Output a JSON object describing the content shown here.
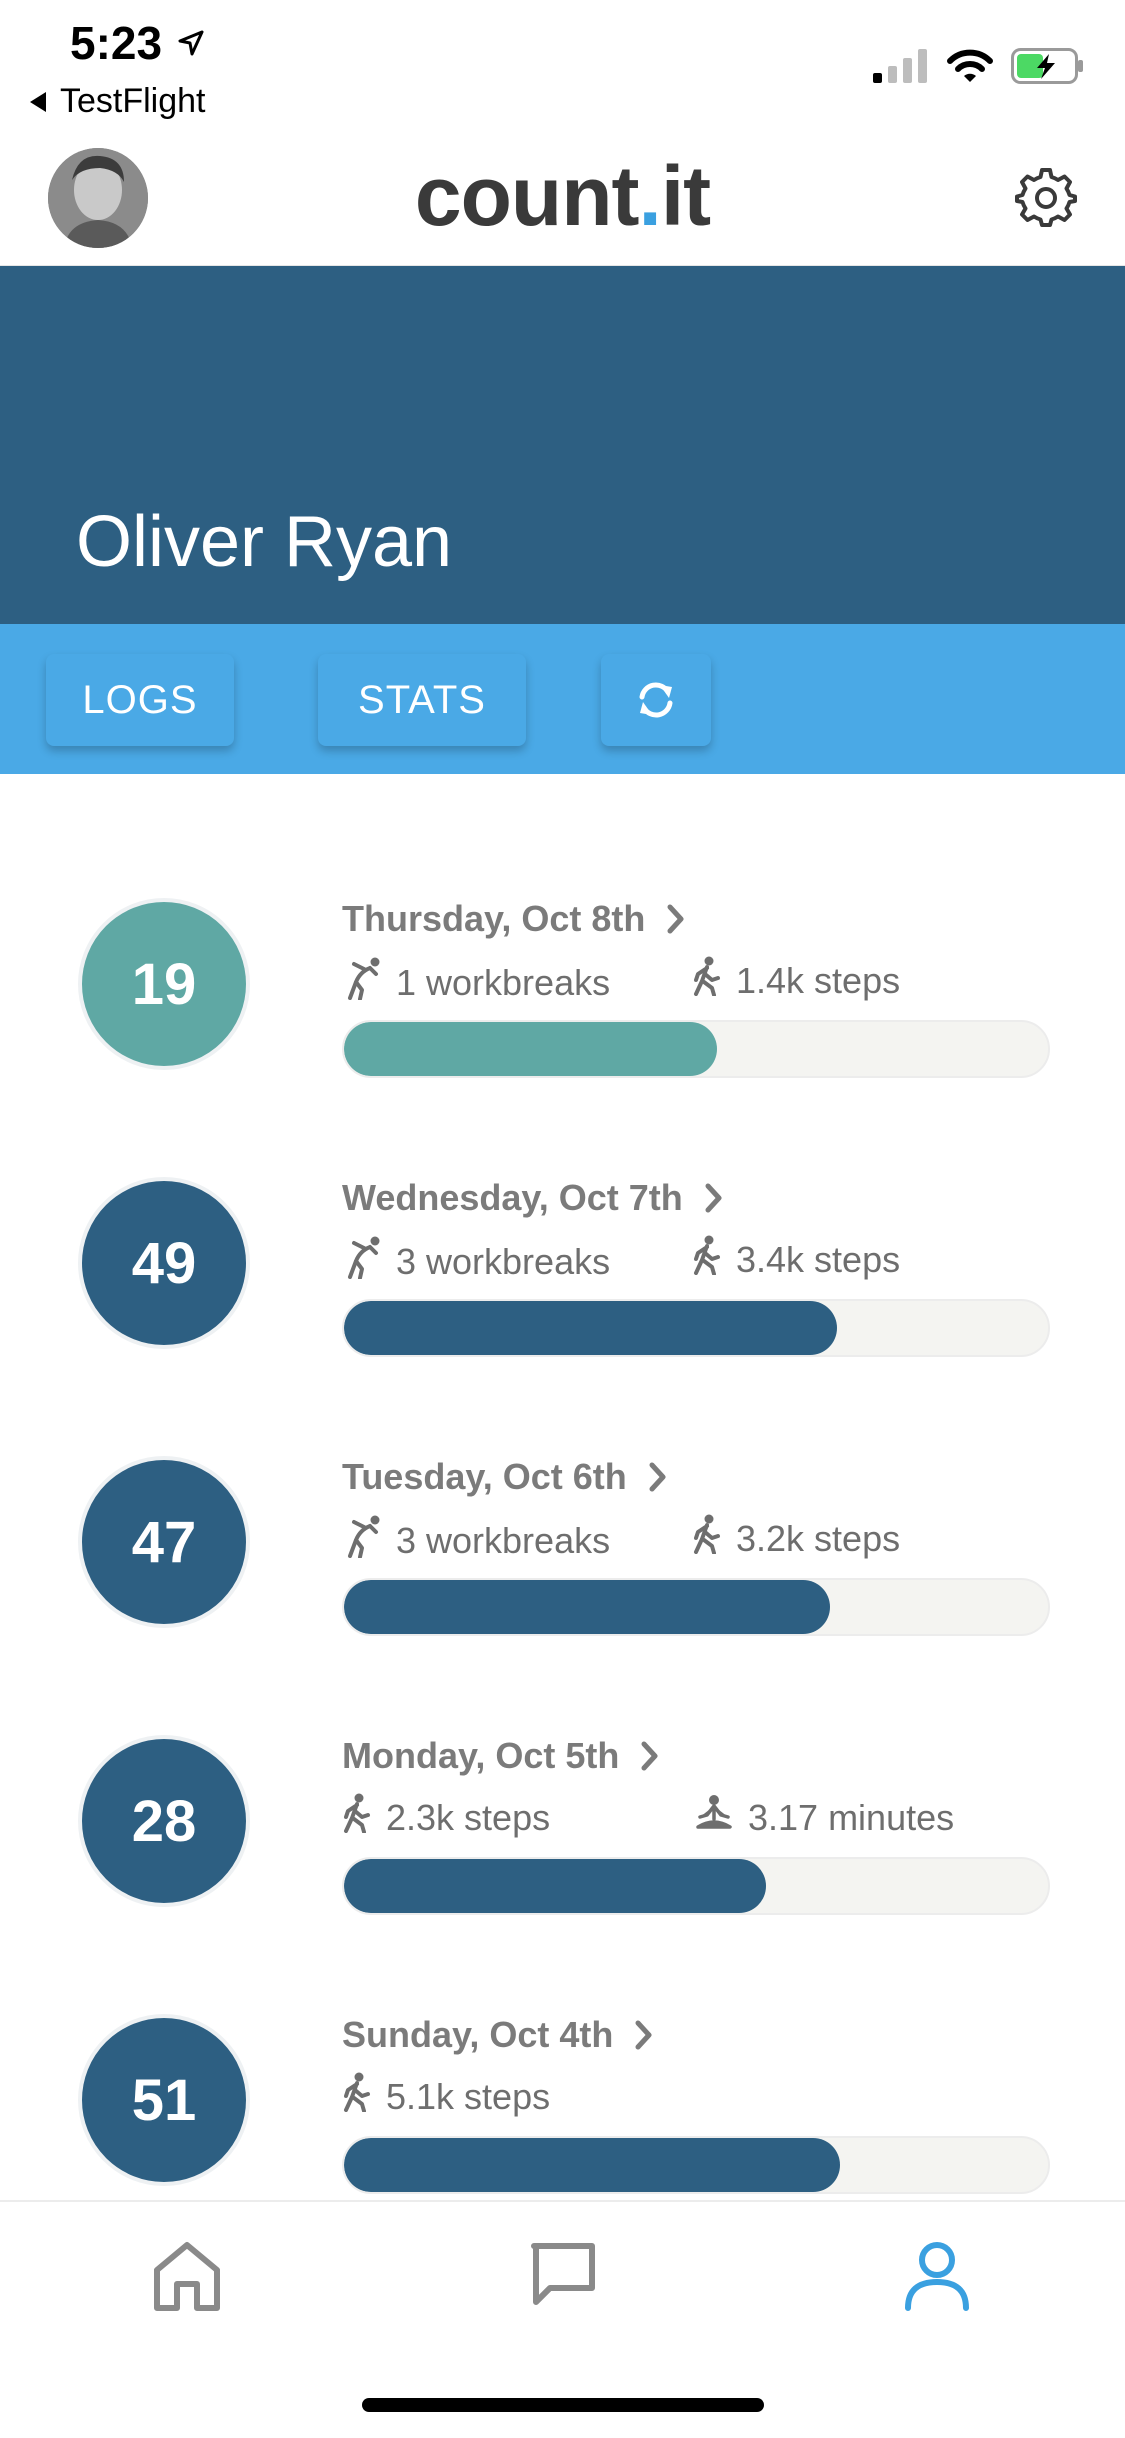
{
  "status_bar": {
    "time": "5:23",
    "back_app": "TestFlight",
    "battery_color": "#4cd964"
  },
  "header": {
    "logo_main": "count",
    "logo_dot": ".",
    "logo_suffix": "it",
    "logo_accent": "#3aa0e0"
  },
  "profile": {
    "name": "Oliver Ryan",
    "banner_color": "#2d5f82"
  },
  "tabs": {
    "logs_label": "LOGS",
    "stats_label": "STATS",
    "bar_color": "#4aa9e6"
  },
  "logs": [
    {
      "score": "19",
      "date": "Thursday, Oct 8th",
      "m1_icon": "stretch-icon",
      "m1_text": "1 workbreaks",
      "m2_icon": "walk-icon",
      "m2_text": "1.4k steps",
      "progress": 0.53,
      "color": "#5fa8a4"
    },
    {
      "score": "49",
      "date": "Wednesday, Oct 7th",
      "m1_icon": "stretch-icon",
      "m1_text": "3 workbreaks",
      "m2_icon": "walk-icon",
      "m2_text": "3.4k steps",
      "progress": 0.7,
      "color": "#2d5f82"
    },
    {
      "score": "47",
      "date": "Tuesday, Oct 6th",
      "m1_icon": "stretch-icon",
      "m1_text": "3 workbreaks",
      "m2_icon": "walk-icon",
      "m2_text": "3.2k steps",
      "progress": 0.69,
      "color": "#2d5f82"
    },
    {
      "score": "28",
      "date": "Monday, Oct 5th",
      "m1_icon": "walk-icon",
      "m1_text": "2.3k steps",
      "m2_icon": "meditation-icon",
      "m2_text": "3.17 minutes",
      "progress": 0.6,
      "color": "#2d5f82"
    },
    {
      "score": "51",
      "date": "Sunday, Oct 4th",
      "m1_icon": "walk-icon",
      "m1_text": "5.1k steps",
      "m2_icon": "",
      "m2_text": "",
      "progress": 0.705,
      "color": "#2d5f82"
    }
  ],
  "bottom_nav": {
    "items": [
      "home-icon",
      "chat-icon",
      "profile-icon"
    ],
    "active": "profile-icon",
    "active_color": "#3aa0e0",
    "inactive_color": "#8a8a8a"
  }
}
